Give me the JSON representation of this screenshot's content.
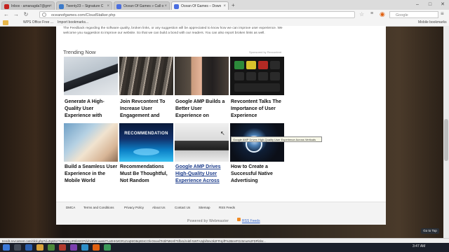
{
  "browser": {
    "tabs": [
      {
        "label": "Inbox - amanagda7@gm",
        "icon_color": "#c5221f"
      },
      {
        "label": "Twenty23 – Signature C",
        "icon_color": "#3c7ac9"
      },
      {
        "label": "Ocean Of Games » Call o",
        "icon_color": "#4a6ee0"
      },
      {
        "label": "Ocean Of Games – Down",
        "icon_color": "#4a6ee0"
      }
    ],
    "address": "oceanofgames.com/CloudStalker.php",
    "search_placeholder": "Google",
    "bookmarks": {
      "item1": "WPS Office Free ...",
      "item2": "Import bookmarks...",
      "mobile": "Mobile bookmarks"
    },
    "status_url": "trends.revcontent.com/click.php?d=Zq4ZuY%2BoNLpR6lvWGPdvlnv6WIoaw6Z7uo0HKMGR1ZUqNtGBqKEsCOb-0rneel7K6lFMKHfrTcfb4Lhni5f-NWTA2qbiftmv3k2FFHpfF%2BnHFGzSmu%2FDPl4lnr..."
  },
  "page": {
    "intro": "The Feedback regarding the software quality, broken links, or any suggestion will be appreciated to know how we can improve user experience. We welcome you suggestion to improve our website. So that we can build a bond with our readers. You can also report broken links as well.",
    "trending_title": "Trending Now",
    "sponsor": "Sponsored by Revcontent",
    "items": [
      {
        "title": "Generate A High-Quality User Experience with",
        "link": false
      },
      {
        "title": "Join Revcontent To Increase User Engagement and",
        "link": false
      },
      {
        "title": "Google AMP Builds a Better User Experience on",
        "link": false
      },
      {
        "title": "Revcontent Talks The Importance of User Experience",
        "link": false
      },
      {
        "title": "Build a Seamless User Experience in the Mobile World",
        "link": false
      },
      {
        "title": "Recommendations Must Be Thoughtful, Not Random",
        "link": false
      },
      {
        "title": "Google AMP Drives High-Quality User Experience Across",
        "link": true
      },
      {
        "title": "How to Create a Successful Native Advertising",
        "link": false
      }
    ],
    "recommendation_label": "RECOMMENDATION",
    "tooltip": "Google AMP Drives High-Quality User Experience Across Verticals"
  },
  "footer": {
    "links": [
      "DMCA",
      "Terms and Conditions",
      "Privacy Policy",
      "About Us",
      "Contact Us",
      "Sitemap",
      "RSS Feeds"
    ],
    "powered": "Powered by Webmaster",
    "rss": "RSS Feeds",
    "go_top": "Go to Top"
  },
  "taskbar": {
    "time": "3:47 AM"
  }
}
